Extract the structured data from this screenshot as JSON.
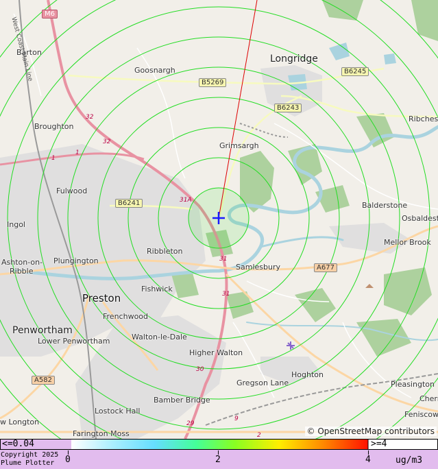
{
  "map": {
    "places": [
      {
        "name": "Barton",
        "kind": "village"
      },
      {
        "name": "Goosnargh",
        "kind": "village"
      },
      {
        "name": "Longridge",
        "kind": "town"
      },
      {
        "name": "Broughton",
        "kind": "village"
      },
      {
        "name": "Ribchester",
        "kind": "village"
      },
      {
        "name": "Grimsargh",
        "kind": "village"
      },
      {
        "name": "Fulwood",
        "kind": "village"
      },
      {
        "name": "Balderstone",
        "kind": "village"
      },
      {
        "name": "Osbaldeston",
        "kind": "village"
      },
      {
        "name": "Ingol",
        "kind": "village"
      },
      {
        "name": "Mellor Brook",
        "kind": "village"
      },
      {
        "name": "Ashton-on-",
        "kind": "village"
      },
      {
        "name": "Ribble",
        "kind": "village"
      },
      {
        "name": "Plungington",
        "kind": "village"
      },
      {
        "name": "Ribbleton",
        "kind": "village"
      },
      {
        "name": "Samlesbury",
        "kind": "village"
      },
      {
        "name": "Preston",
        "kind": "city"
      },
      {
        "name": "Fishwick",
        "kind": "village"
      },
      {
        "name": "Penwortham",
        "kind": "town"
      },
      {
        "name": "Frenchwood",
        "kind": "village"
      },
      {
        "name": "Lower Penwortham",
        "kind": "village"
      },
      {
        "name": "Walton-le-Dale",
        "kind": "village"
      },
      {
        "name": "Higher Walton",
        "kind": "village"
      },
      {
        "name": "Hoghton",
        "kind": "village"
      },
      {
        "name": "Gregson Lane",
        "kind": "village"
      },
      {
        "name": "Pleasington",
        "kind": "village"
      },
      {
        "name": "Cherry",
        "kind": "village"
      },
      {
        "name": "Feniscowles",
        "kind": "village"
      },
      {
        "name": "Bamber Bridge",
        "kind": "village"
      },
      {
        "name": "Lostock Hall",
        "kind": "village"
      },
      {
        "name": "w Longton",
        "kind": "village"
      },
      {
        "name": "Farington Moss",
        "kind": "village"
      }
    ],
    "road_labels": [
      "M6",
      "B5269",
      "B6245",
      "B6243",
      "B6241",
      "A677",
      "A582"
    ],
    "junction_labels": [
      "32",
      "32",
      "31A",
      "31",
      "31",
      "30",
      "29",
      "9",
      "2",
      "1",
      "1"
    ],
    "rail_label": "West Coast Main Line",
    "attribution": "© OpenStreetMap contributors",
    "source_marker": "plus-marker",
    "colors": {
      "contour": "#22dd22",
      "marker": "#1a1aff",
      "direction_line": "#dd0000",
      "motorway": "#e892a2",
      "primary": "#fcd6a4",
      "secondary": "#f7fabf",
      "water": "#aad3df",
      "woodland": "#add19e",
      "urban": "#e0dfdf"
    }
  },
  "legend": {
    "min_label": "<=0.04",
    "max_label": ">=4",
    "tick_labels": [
      "0",
      "2",
      "4"
    ],
    "units": "ug/m3",
    "copyright": "Copyright 2025",
    "app_name": "Plume Plotter"
  }
}
